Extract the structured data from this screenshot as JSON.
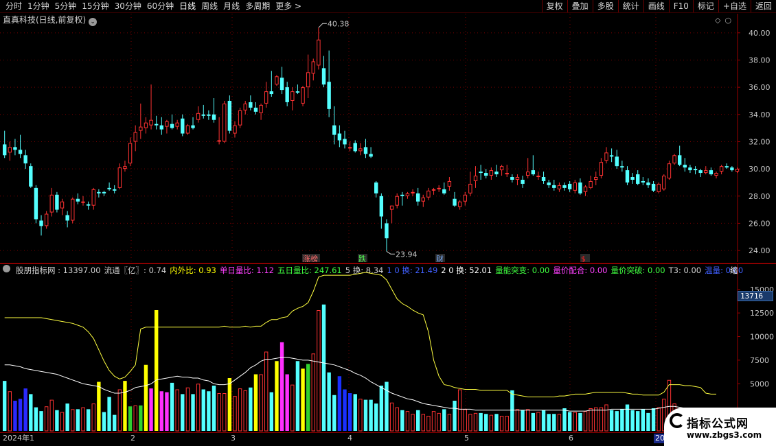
{
  "toolbar": {
    "left": [
      "分时",
      "1分钟",
      "5分钟",
      "15分钟",
      "30分钟",
      "60分钟",
      "日线",
      "周线",
      "月线",
      "多周期",
      "更多 >"
    ],
    "active_index": 6,
    "right": [
      "复权",
      "叠加",
      "多股",
      "统计",
      "画线",
      "F10",
      "标记",
      "+自选",
      "返回"
    ]
  },
  "chart": {
    "title": "直真科技(日线,前复权)",
    "high_marker": "40.38",
    "low_marker": "23.94",
    "y_ticks": [
      "40.00",
      "38.00",
      "36.00",
      "34.00",
      "32.00",
      "30.00",
      "28.00",
      "26.00",
      "24.00"
    ],
    "event_tags": [
      {
        "text": "涨榜",
        "color": "#ff6a6a"
      },
      {
        "text": "跌",
        "color": "#52ff52"
      },
      {
        "text": "财",
        "color": "#7ab0ff"
      },
      {
        "text": "$",
        "color": "#ff2020"
      }
    ]
  },
  "indicator": {
    "items": [
      {
        "text": "股朋指标网 : 13397.00",
        "color": "#d0d0d0"
      },
      {
        "text": "流通〖亿〗: 0.74",
        "color": "#d0d0d0"
      },
      {
        "text": "内外比: 0.93",
        "color": "#ffff00"
      },
      {
        "text": "单日量比: 1.12",
        "color": "#ff40ff"
      },
      {
        "text": "五日量比: 247.61",
        "color": "#40ff40"
      },
      {
        "text": "5 换: 8.34",
        "color": "#d0d0d0"
      },
      {
        "text": "1 0 换: 21.49",
        "color": "#4060ff"
      },
      {
        "text": "2 0 换: 52.01",
        "color": "#ffffff"
      },
      {
        "text": "量能突变: 0.00",
        "color": "#40ff40"
      },
      {
        "text": "量价配合: 0.00",
        "color": "#ff40ff"
      },
      {
        "text": "量价突破: 0.00",
        "color": "#40ff40"
      },
      {
        "text": "T3: 0.00",
        "color": "#d0d0d0"
      },
      {
        "text": "温量: 0.00",
        "color": "#4060ff"
      }
    ],
    "more": "缩",
    "y_ticks": [
      "15000",
      "12500",
      "10000",
      "7500",
      "5000"
    ],
    "current_value": "13716"
  },
  "dates": [
    {
      "text": "2024年1"
    },
    {
      "text": "2"
    },
    {
      "text": "3"
    },
    {
      "text": "4"
    },
    {
      "text": "5"
    },
    {
      "text": "6"
    },
    {
      "text": "202"
    }
  ],
  "watermark": {
    "title": "指标公式网",
    "url": "www.zbgs3.com"
  },
  "chart_data": {
    "type": "candlestick",
    "title": "直真科技(日线,前复权)",
    "ylim": [
      23.5,
      41
    ],
    "bars": [
      [
        31.8,
        32.8,
        30.8,
        31.0
      ],
      [
        31.2,
        32.0,
        30.6,
        31.6
      ],
      [
        31.6,
        32.2,
        31.0,
        31.4
      ],
      [
        31.4,
        32.5,
        30.8,
        31.1
      ],
      [
        31.0,
        31.4,
        30.0,
        30.4
      ],
      [
        30.2,
        30.4,
        28.6,
        28.7
      ],
      [
        28.6,
        28.8,
        26.0,
        26.3
      ],
      [
        26.2,
        26.6,
        25.1,
        25.8
      ],
      [
        25.8,
        26.9,
        25.6,
        26.7
      ],
      [
        26.8,
        28.6,
        26.5,
        28.1
      ],
      [
        28.1,
        28.3,
        26.8,
        27.0
      ],
      [
        27.1,
        27.8,
        26.6,
        27.6
      ],
      [
        26.6,
        26.9,
        25.7,
        26.2
      ],
      [
        26.2,
        27.9,
        26.0,
        27.8
      ],
      [
        27.8,
        28.2,
        27.4,
        27.6
      ],
      [
        27.5,
        28.0,
        27.3,
        27.6
      ],
      [
        27.4,
        27.6,
        27.0,
        27.3
      ],
      [
        27.3,
        28.6,
        27.0,
        28.5
      ],
      [
        28.3,
        28.5,
        27.9,
        28.2
      ],
      [
        28.3,
        28.4,
        28.0,
        28.2
      ],
      [
        28.6,
        29.0,
        28.4,
        28.5
      ],
      [
        28.5,
        28.8,
        28.2,
        28.4
      ],
      [
        28.6,
        30.4,
        28.5,
        30.1
      ],
      [
        30.0,
        30.6,
        29.8,
        30.2
      ],
      [
        30.4,
        32.3,
        30.2,
        31.9
      ],
      [
        32.0,
        33.2,
        31.3,
        32.7
      ],
      [
        32.8,
        34.8,
        32.2,
        33.1
      ],
      [
        33.0,
        33.8,
        32.6,
        33.4
      ],
      [
        33.2,
        36.2,
        32.9,
        33.6
      ],
      [
        33.3,
        33.9,
        32.9,
        33.2
      ],
      [
        33.2,
        33.8,
        32.5,
        32.9
      ],
      [
        33.1,
        33.6,
        32.6,
        33.5
      ],
      [
        33.3,
        34.0,
        32.9,
        33.0
      ],
      [
        33.1,
        33.6,
        32.9,
        33.4
      ],
      [
        33.7,
        34.0,
        32.4,
        32.6
      ],
      [
        32.6,
        33.3,
        32.5,
        33.2
      ],
      [
        33.2,
        33.8,
        32.9,
        33.0
      ],
      [
        33.6,
        34.6,
        33.4,
        34.1
      ],
      [
        34.0,
        34.7,
        33.7,
        33.9
      ],
      [
        34.0,
        34.3,
        33.6,
        33.9
      ],
      [
        34.0,
        35.2,
        33.4,
        33.6
      ],
      [
        32.0,
        33.8,
        31.8,
        32.1
      ],
      [
        32.0,
        35.0,
        31.9,
        34.8
      ],
      [
        35.0,
        35.4,
        32.6,
        32.8
      ],
      [
        32.6,
        33.5,
        32.3,
        33.2
      ],
      [
        33.2,
        34.5,
        33.0,
        34.3
      ],
      [
        34.3,
        35.0,
        34.0,
        34.8
      ],
      [
        34.9,
        35.4,
        34.3,
        34.5
      ],
      [
        34.5,
        34.9,
        34.0,
        34.2
      ],
      [
        34.1,
        34.8,
        33.6,
        34.7
      ],
      [
        34.8,
        36.4,
        34.5,
        35.7
      ],
      [
        35.7,
        37.2,
        35.3,
        35.5
      ],
      [
        36.2,
        36.9,
        36.1,
        36.8
      ],
      [
        36.7,
        37.5,
        35.5,
        35.8
      ],
      [
        36.0,
        36.4,
        34.6,
        34.9
      ],
      [
        35.0,
        36.0,
        34.3,
        35.7
      ],
      [
        35.7,
        36.2,
        35.5,
        35.6
      ],
      [
        34.8,
        36.1,
        34.6,
        36.0
      ],
      [
        36.0,
        38.4,
        35.2,
        37.1
      ],
      [
        37.0,
        38.1,
        36.5,
        37.9
      ],
      [
        37.6,
        40.38,
        37.3,
        39.5
      ],
      [
        37.4,
        38.3,
        36.0,
        36.2
      ],
      [
        36.4,
        38.7,
        33.8,
        34.4
      ],
      [
        33.2,
        34.6,
        31.8,
        32.5
      ],
      [
        32.6,
        33.2,
        31.6,
        32.1
      ],
      [
        32.2,
        32.8,
        31.5,
        31.8
      ],
      [
        31.5,
        32.0,
        31.3,
        31.6
      ],
      [
        31.9,
        32.1,
        31.2,
        31.3
      ],
      [
        31.3,
        31.9,
        31.0,
        31.5
      ],
      [
        31.6,
        32.2,
        30.8,
        31.1
      ],
      [
        31.1,
        31.6,
        30.8,
        30.9
      ],
      [
        29.0,
        29.1,
        27.9,
        28.2
      ],
      [
        28.0,
        28.2,
        25.6,
        26.5
      ],
      [
        26.0,
        26.3,
        23.94,
        24.9
      ],
      [
        27.0,
        27.3,
        26.0,
        27.3
      ],
      [
        27.3,
        28.2,
        27.1,
        28.0
      ],
      [
        28.1,
        28.3,
        27.3,
        28.0
      ],
      [
        28.0,
        28.3,
        27.8,
        28.2
      ],
      [
        28.2,
        28.5,
        28.0,
        28.3
      ],
      [
        28.2,
        28.6,
        27.3,
        27.6
      ],
      [
        27.6,
        28.1,
        27.2,
        27.9
      ],
      [
        27.9,
        28.6,
        27.7,
        28.4
      ],
      [
        28.4,
        28.6,
        28.1,
        28.5
      ],
      [
        28.5,
        28.8,
        28.3,
        28.6
      ],
      [
        28.5,
        29.0,
        28.1,
        28.2
      ],
      [
        28.7,
        29.4,
        28.4,
        29.1
      ],
      [
        27.8,
        28.3,
        27.2,
        27.3
      ],
      [
        27.2,
        27.7,
        27.0,
        27.6
      ],
      [
        27.6,
        28.3,
        27.3,
        28.1
      ],
      [
        28.2,
        29.8,
        28.0,
        28.9
      ],
      [
        29.1,
        30.2,
        28.6,
        29.5
      ],
      [
        29.8,
        30.3,
        29.2,
        29.7
      ],
      [
        29.7,
        30.0,
        29.3,
        29.5
      ],
      [
        29.5,
        30.1,
        29.2,
        29.9
      ],
      [
        29.8,
        30.3,
        29.4,
        29.6
      ],
      [
        29.9,
        30.3,
        29.5,
        30.2
      ],
      [
        29.6,
        30.3,
        29.4,
        29.7
      ],
      [
        29.4,
        29.6,
        29.0,
        29.2
      ],
      [
        29.2,
        29.6,
        28.8,
        29.4
      ],
      [
        29.2,
        29.5,
        28.6,
        28.9
      ],
      [
        29.5,
        30.8,
        29.3,
        29.8
      ],
      [
        29.9,
        31.0,
        29.5,
        29.6
      ],
      [
        29.4,
        29.8,
        29.2,
        29.5
      ],
      [
        29.4,
        29.8,
        28.9,
        29.1
      ],
      [
        29.0,
        29.2,
        28.6,
        28.8
      ],
      [
        28.8,
        29.2,
        28.4,
        28.6
      ],
      [
        28.5,
        29.0,
        28.3,
        28.8
      ],
      [
        28.8,
        29.0,
        28.4,
        28.6
      ],
      [
        28.9,
        29.1,
        28.3,
        28.5
      ],
      [
        28.4,
        29.2,
        28.2,
        29.0
      ],
      [
        29.0,
        29.3,
        28.1,
        28.2
      ],
      [
        28.3,
        28.8,
        28.0,
        28.7
      ],
      [
        28.6,
        29.5,
        28.5,
        29.1
      ],
      [
        29.2,
        29.8,
        28.8,
        29.4
      ],
      [
        29.5,
        30.8,
        29.3,
        30.5
      ],
      [
        30.6,
        31.6,
        30.4,
        31.2
      ],
      [
        31.0,
        31.5,
        30.5,
        30.9
      ],
      [
        30.9,
        31.4,
        30.0,
        30.2
      ],
      [
        30.2,
        30.6,
        29.8,
        30.1
      ],
      [
        29.9,
        30.2,
        28.8,
        29.0
      ],
      [
        29.4,
        29.7,
        28.9,
        29.2
      ],
      [
        29.6,
        29.9,
        28.8,
        28.9
      ],
      [
        29.1,
        29.4,
        28.8,
        29.0
      ],
      [
        29.0,
        29.3,
        28.6,
        28.8
      ],
      [
        28.9,
        29.1,
        28.3,
        28.4
      ],
      [
        28.3,
        29.0,
        28.2,
        28.9
      ],
      [
        28.5,
        29.6,
        28.4,
        29.5
      ],
      [
        29.3,
        30.6,
        29.2,
        30.4
      ],
      [
        30.4,
        31.1,
        30.3,
        31.0
      ],
      [
        31.0,
        31.7,
        30.2,
        30.3
      ],
      [
        30.3,
        30.8,
        29.8,
        30.1
      ],
      [
        30.1,
        30.3,
        29.7,
        29.9
      ],
      [
        30.0,
        30.2,
        29.6,
        29.9
      ],
      [
        29.9,
        30.0,
        29.4,
        29.7
      ],
      [
        29.7,
        30.2,
        29.6,
        29.9
      ],
      [
        29.9,
        30.1,
        29.5,
        29.6
      ],
      [
        29.5,
        29.8,
        29.3,
        29.7
      ],
      [
        29.8,
        30.3,
        29.6,
        30.2
      ],
      [
        30.2,
        30.4,
        30.0,
        30.1
      ],
      [
        30.1,
        30.2,
        29.8,
        29.9
      ],
      [
        29.8,
        30.1,
        29.7,
        30.0
      ]
    ],
    "volume_ylim": [
      0,
      16000
    ],
    "volume": [
      5300,
      4200,
      3200,
      3400,
      4500,
      3900,
      2500,
      2100,
      2600,
      3300,
      2200,
      2000,
      2900,
      2300,
      2300,
      2500,
      2300,
      2900,
      5200,
      2000,
      3600,
      1700,
      4400,
      5300,
      2600,
      2700,
      2700,
      7000,
      4500,
      12800,
      4200,
      4100,
      5100,
      4400,
      3900,
      4600,
      3900,
      5000,
      4400,
      4200,
      4800,
      4000,
      4000,
      5600,
      3700,
      4500,
      4300,
      4600,
      6000,
      6000,
      8400,
      4100,
      7400,
      9400,
      6000,
      4900,
      7400,
      6600,
      7100,
      8200,
      12800,
      13397,
      6200,
      3800,
      5800,
      4400,
      4000,
      3900,
      3400,
      3300,
      3300,
      2900,
      4800,
      5200,
      3000,
      2500,
      2200,
      2100,
      1800,
      2200,
      1800,
      1600,
      2100,
      1900,
      2300,
      1800,
      3200,
      4400,
      2300,
      1800,
      1900,
      1900,
      1800,
      1700,
      1800,
      1600,
      1600,
      4300,
      2300,
      2200,
      2300,
      1900,
      2000,
      2200,
      1800,
      1800,
      1800,
      2400,
      2000,
      2000,
      1900,
      2100,
      2400,
      2500,
      2500,
      2800,
      2200,
      2100,
      2300,
      2800,
      2200,
      2100,
      2300,
      1900,
      2400,
      2500,
      3400,
      5400,
      2900,
      1800,
      1800,
      1700,
      1800,
      1800,
      2000,
      1900,
      1700
    ],
    "ma_long": [
      12000,
      12000,
      12000,
      12000,
      12000,
      12000,
      12000,
      12000,
      11900,
      11800,
      11700,
      11600,
      11500,
      11400,
      11200,
      11000,
      10500,
      9800,
      8600,
      7400,
      6400,
      5800,
      5500,
      5700,
      6300,
      7000,
      10800,
      11000,
      11000,
      11000,
      11000,
      11000,
      11000,
      11000,
      11000,
      11000,
      11000,
      11000,
      11000,
      11000,
      11000,
      11000,
      11100,
      11000,
      11000,
      11000,
      11100,
      11000,
      11100,
      11100,
      11500,
      11800,
      11800,
      12000,
      12100,
      12700,
      13000,
      13200,
      13600,
      14800,
      16300,
      16500,
      16500,
      16500,
      16500,
      16500,
      16500,
      16600,
      16700,
      16800,
      16700,
      16600,
      16500,
      16000,
      15000,
      14000,
      13500,
      13200,
      12800,
      12500,
      12300,
      10500,
      7500,
      5800,
      4900,
      4800,
      4600,
      4500,
      4400,
      4400,
      4400,
      4300,
      4300,
      4300,
      4300,
      4300,
      4300,
      3900,
      3800,
      3700,
      3600,
      3600,
      3600,
      3600,
      3600,
      3600,
      3700,
      3700,
      3800,
      3900,
      3900,
      3900,
      4000,
      4100,
      4100,
      4100,
      4100,
      4100,
      4100,
      4000,
      3900,
      3900,
      3800,
      3800,
      3800,
      3800,
      4100,
      4900,
      4900,
      4900,
      4800,
      4800,
      4700,
      4600,
      4000,
      3900,
      3900
    ],
    "ma_short": [
      7000,
      7000,
      6900,
      6800,
      6600,
      6500,
      6400,
      6300,
      6200,
      6100,
      6000,
      5800,
      5600,
      5400,
      5200,
      5000,
      4900,
      4800,
      4700,
      4400,
      4200,
      4000,
      4000,
      4100,
      4300,
      4600,
      4700,
      4800,
      5000,
      5400,
      5500,
      5600,
      5700,
      5800,
      5700,
      5700,
      5600,
      5600,
      5400,
      5300,
      5000,
      4900,
      4900,
      5000,
      5400,
      5800,
      6200,
      6700,
      7000,
      7400,
      7600,
      7600,
      7700,
      7800,
      7800,
      7700,
      7600,
      7500,
      7500,
      7400,
      7300,
      7200,
      7100,
      7000,
      6800,
      6600,
      6400,
      6100,
      5900,
      5600,
      5200,
      4900,
      4600,
      4300,
      4000,
      3800,
      3600,
      3400,
      3300,
      3100,
      2900,
      2800,
      2700,
      2600,
      2500,
      2400,
      2400,
      2300,
      2300,
      2300,
      2200,
      2200,
      2200,
      2200,
      2200,
      2200,
      2200,
      2200,
      2200,
      2200,
      2200,
      2200,
      2200,
      2200,
      2200,
      2200,
      2200,
      2200,
      2100,
      2100,
      2100,
      2100,
      2200,
      2200,
      2200,
      2200,
      2300,
      2300,
      2300,
      2300,
      2300,
      2300,
      2300,
      2300,
      2300,
      2400,
      2500,
      2600,
      2600,
      2500,
      2400,
      2300,
      2200,
      2100,
      2000,
      2000,
      2000
    ]
  }
}
